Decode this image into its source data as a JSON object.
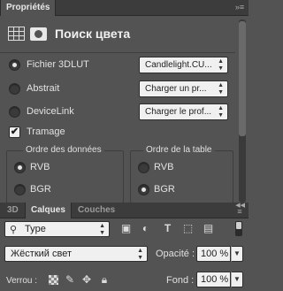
{
  "properties_panel": {
    "tab_label": "Propriétés",
    "title": "Поиск цвета",
    "rows": [
      {
        "label": "Fichier 3DLUT",
        "selected": true,
        "value": "Candlelight.CU..."
      },
      {
        "label": "Abstrait",
        "selected": false,
        "value": "Charger un pr..."
      },
      {
        "label": "DeviceLink",
        "selected": false,
        "value": "Charger le prof..."
      }
    ],
    "dither": {
      "label": "Tramage",
      "checked": true,
      "mark": "✔"
    },
    "data_order": {
      "title": "Ordre des données",
      "options": [
        {
          "label": "RVB",
          "selected": true
        },
        {
          "label": "BGR",
          "selected": false
        }
      ]
    },
    "table_order": {
      "title": "Ordre de la table",
      "options": [
        {
          "label": "RVB",
          "selected": false
        },
        {
          "label": "BGR",
          "selected": true
        }
      ]
    }
  },
  "layers_panel": {
    "tabs": [
      "3D",
      "Calques",
      "Couches"
    ],
    "active_tab": "Calques",
    "filter": {
      "value": "Type"
    },
    "blend_mode": "Жёсткий свет",
    "opacity": {
      "label": "Opacité :",
      "value": "100 %"
    },
    "lock": {
      "label": "Verrou :"
    },
    "fill": {
      "label": "Fond :",
      "value": "100 %"
    }
  },
  "icons": {
    "menu": "panel-menu-icon",
    "collapse": "collapse-icon",
    "search": "search-icon",
    "arrows": "select-arrows-icon"
  }
}
